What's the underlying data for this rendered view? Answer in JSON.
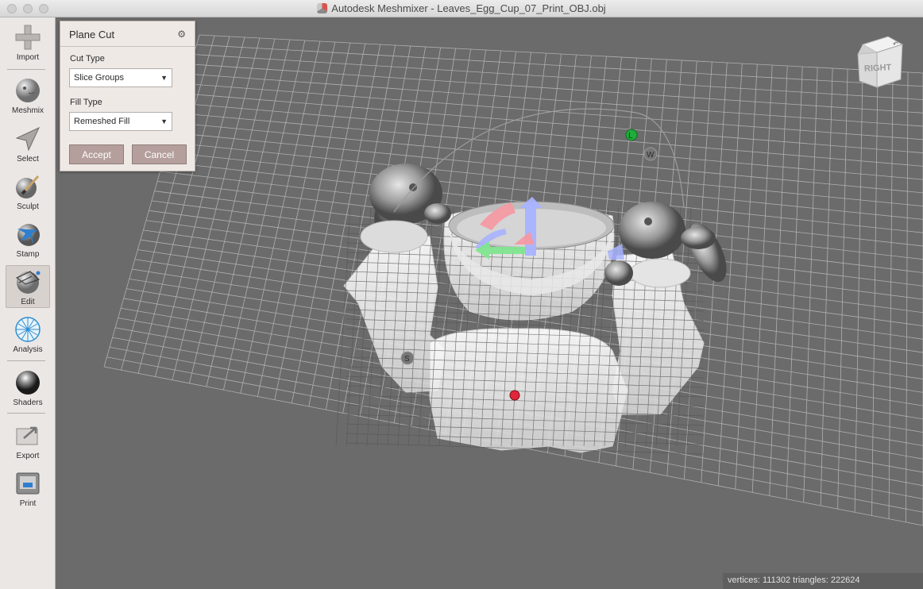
{
  "window": {
    "title": "Autodesk Meshmixer - Leaves_Egg_Cup_07_Print_OBJ.obj"
  },
  "toolbar": {
    "items": [
      {
        "label": "Import",
        "icon": "plus-icon"
      },
      {
        "label": "Meshmix",
        "icon": "bunny-head-icon"
      },
      {
        "label": "Select",
        "icon": "arrow-cursor-icon"
      },
      {
        "label": "Sculpt",
        "icon": "brush-icon"
      },
      {
        "label": "Stamp",
        "icon": "stamp-icon"
      },
      {
        "label": "Edit",
        "icon": "edit-mesh-icon"
      },
      {
        "label": "Analysis",
        "icon": "analysis-sphere-icon"
      },
      {
        "label": "Shaders",
        "icon": "shader-sphere-icon"
      },
      {
        "label": "Export",
        "icon": "export-icon"
      },
      {
        "label": "Print",
        "icon": "printer-icon"
      }
    ],
    "active": "Edit"
  },
  "panel": {
    "title": "Plane Cut",
    "settings_icon": "gear-icon",
    "cut_type_label": "Cut Type",
    "cut_type_value": "Slice Groups",
    "fill_type_label": "Fill Type",
    "fill_type_value": "Remeshed Fill",
    "accept_label": "Accept",
    "cancel_label": "Cancel"
  },
  "viewcube": {
    "face_label": "RIGHT"
  },
  "gizmo": {
    "l_label": "L",
    "w_label": "W",
    "s_label": "S"
  },
  "status": {
    "text": "vertices: 111302 triangles: 222624"
  },
  "colors": {
    "viewport_bg": "#6b6b6b",
    "panel_bg": "#efe9e6",
    "button_bg": "#b59f9c",
    "gizmo_green": "#1fae3a",
    "gizmo_red": "#e0263a",
    "gizmo_blue": "#9aa6ff"
  }
}
